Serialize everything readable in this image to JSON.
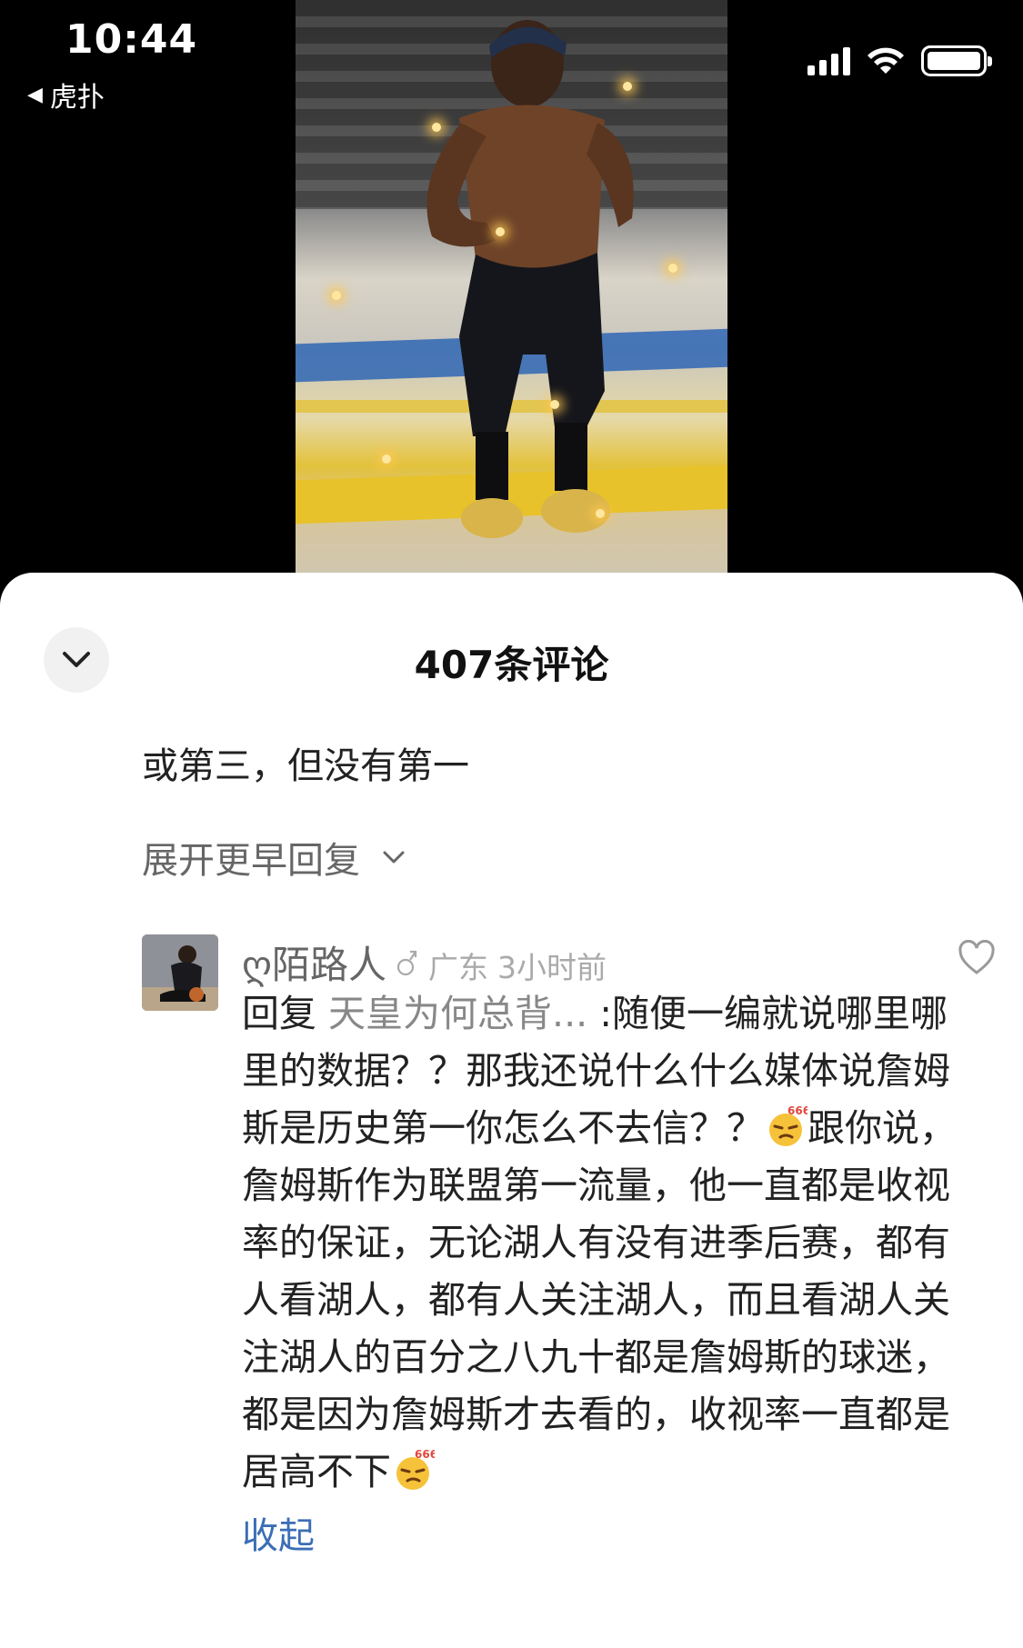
{
  "status_bar": {
    "time": "10:44",
    "back_app": "虎扑",
    "back_icon": "back-triangle-icon",
    "signal_icon": "cellular-signal-icon",
    "wifi_icon": "wifi-icon",
    "battery_icon": "battery-icon"
  },
  "video": {
    "description_icon": "video-frame"
  },
  "sheet": {
    "title": "407条评论",
    "collapse_icon": "chevron-down-icon"
  },
  "previous_reply": {
    "text": "或第三，但没有第一"
  },
  "expand_earlier": {
    "label": "展开更早回复",
    "icon": "chevron-down-icon"
  },
  "comment": {
    "username": "ღ陌路人",
    "location": "广东",
    "time_ago": "3小时前",
    "reply_prefix": "回复 ",
    "reply_target": "天皇为何总背...",
    "segment_1": " :随便一编就说哪里哪里的数据？？那我还说什么什么媒体说詹姆斯是历史第一你怎么不去信？？",
    "emoji_label": "666",
    "segment_2": "跟你说，詹姆斯作为联盟第一流量，他一直都是收视率的保证，无论湖人有没有进季后赛，都有人看湖人，都有人关注湖人，而且看湖人关注湖人的百分之八九十都是詹姆斯的球迷，都是因为詹姆斯才去看的，收视率一直都是居高不下",
    "collapse_label": "收起",
    "like_icon": "heart-outline-icon"
  },
  "colors": {
    "accent_link": "#3b6eb5",
    "muted_text": "#888888",
    "background": "#ffffff"
  }
}
